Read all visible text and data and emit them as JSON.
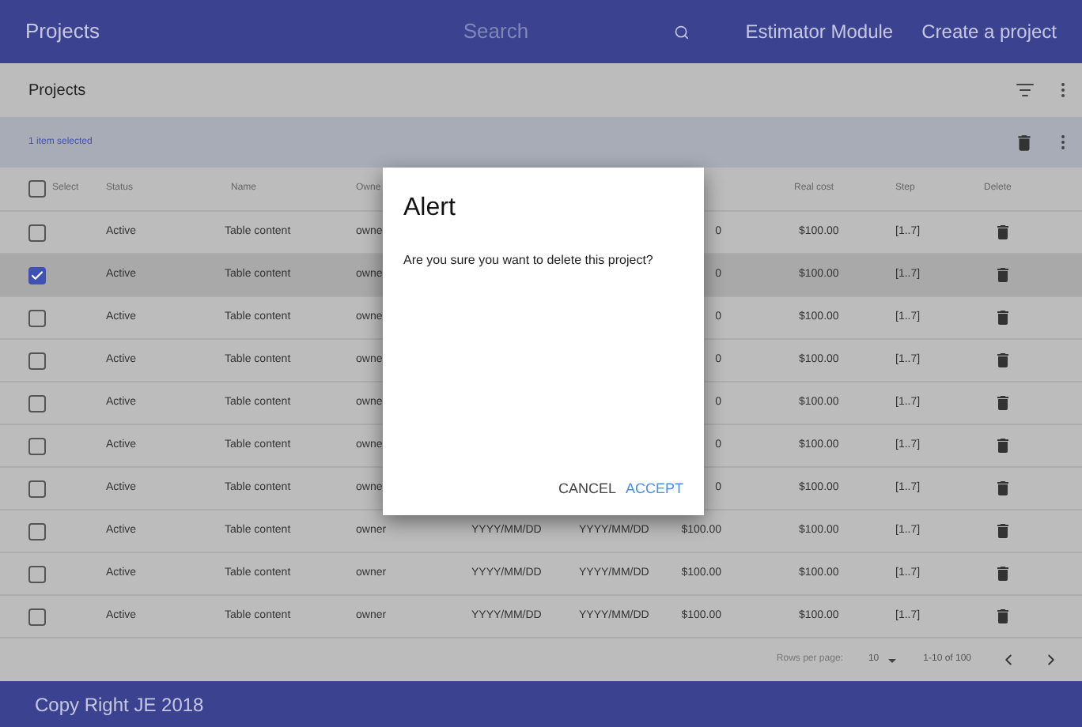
{
  "app_bar": {
    "title": "Projects",
    "search": {
      "placeholder": "Search"
    },
    "links": [
      "Estimator Module",
      "Create a project"
    ]
  },
  "toolbar": {
    "title": "Projects"
  },
  "selection_bar": {
    "text": "1 item selected"
  },
  "table": {
    "select_all": {
      "checked": false,
      "label": "Select"
    },
    "columns": {
      "status": "Status",
      "name": "Name",
      "owner": "Owne",
      "real_cost": "Real cost",
      "step": "Step",
      "delete": "Delete"
    },
    "rows": [
      {
        "selected": false,
        "status": "Active",
        "name": "Table content",
        "owner": "owne",
        "column_6": "0",
        "real_cost": "$100.00",
        "step": "[1..7]"
      },
      {
        "selected": true,
        "status": "Active",
        "name": "Table content",
        "owner": "owne",
        "column_6": "0",
        "real_cost": "$100.00",
        "step": "[1..7]"
      },
      {
        "selected": false,
        "status": "Active",
        "name": "Table content",
        "owner": "owne",
        "column_6": "0",
        "real_cost": "$100.00",
        "step": "[1..7]"
      },
      {
        "selected": false,
        "status": "Active",
        "name": "Table content",
        "owner": "owne",
        "column_6": "0",
        "real_cost": "$100.00",
        "step": "[1..7]"
      },
      {
        "selected": false,
        "status": "Active",
        "name": "Table content",
        "owner": "owne",
        "column_6": "0",
        "real_cost": "$100.00",
        "step": "[1..7]"
      },
      {
        "selected": false,
        "status": "Active",
        "name": "Table content",
        "owner": "owne",
        "column_6": "0",
        "real_cost": "$100.00",
        "step": "[1..7]"
      },
      {
        "selected": false,
        "status": "Active",
        "name": "Table content",
        "owner": "owne",
        "column_6": "0",
        "real_cost": "$100.00",
        "step": "[1..7]"
      },
      {
        "selected": false,
        "status": "Active",
        "name": "Table content",
        "owner": "owner",
        "column_4": "YYYY/MM/DD",
        "column_5": "YYYY/MM/DD",
        "column_6": "$100.00",
        "real_cost": "$100.00",
        "step": "[1..7]"
      },
      {
        "selected": false,
        "status": "Active",
        "name": "Table content",
        "owner": "owner",
        "column_4": "YYYY/MM/DD",
        "column_5": "YYYY/MM/DD",
        "column_6": "$100.00",
        "real_cost": "$100.00",
        "step": "[1..7]"
      },
      {
        "selected": false,
        "status": "Active",
        "name": "Table content",
        "owner": "owner",
        "column_4": "YYYY/MM/DD",
        "column_5": "YYYY/MM/DD",
        "column_6": "$100.00",
        "real_cost": "$100.00",
        "step": "[1..7]"
      }
    ]
  },
  "pagination": {
    "rows_per_page_label": "Rows per page:",
    "rows_per_page": "10",
    "range": "1-10 of 100"
  },
  "footer": {
    "text": "Copy Right JE 2018"
  },
  "dialog": {
    "title": "Alert",
    "message": "Are you sure you want to delete this project?",
    "buttons": [
      {
        "label": "CANCEL",
        "kind": "cancel"
      },
      {
        "label": "ACCEPT",
        "kind": "accept"
      }
    ]
  }
}
